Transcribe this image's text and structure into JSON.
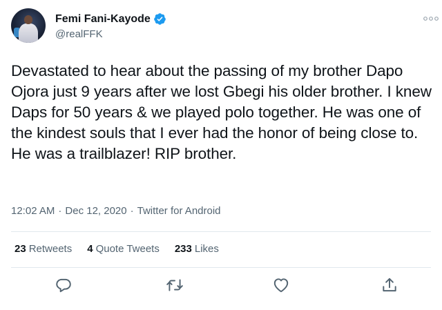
{
  "user": {
    "display_name": "Femi Fani-Kayode",
    "handle": "@realFFK",
    "verified": true
  },
  "tweet": {
    "text": "Devastated to hear about the passing of my brother Dapo Ojora just 9 years after we lost Gbegi his older brother. I knew Daps for 50 years & we played polo together. He was one of the kindest souls that I ever had the honor of being close to. He was a trailblazer! RIP brother.",
    "time": "12:02 AM",
    "date": "Dec 12, 2020",
    "source": "Twitter for Android",
    "separator": "·"
  },
  "stats": {
    "retweets_count": "23",
    "retweets_label": "Retweets",
    "quotes_count": "4",
    "quotes_label": "Quote Tweets",
    "likes_count": "233",
    "likes_label": "Likes"
  },
  "icons": {
    "more": "more-horizontal-icon",
    "reply": "reply-icon",
    "retweet": "retweet-icon",
    "like": "heart-icon",
    "share": "share-icon",
    "verified": "verified-badge-icon"
  },
  "colors": {
    "text": "#0f1419",
    "secondary": "#536471",
    "verified_blue": "#1d9bf0",
    "divider": "#e1e8ed"
  }
}
